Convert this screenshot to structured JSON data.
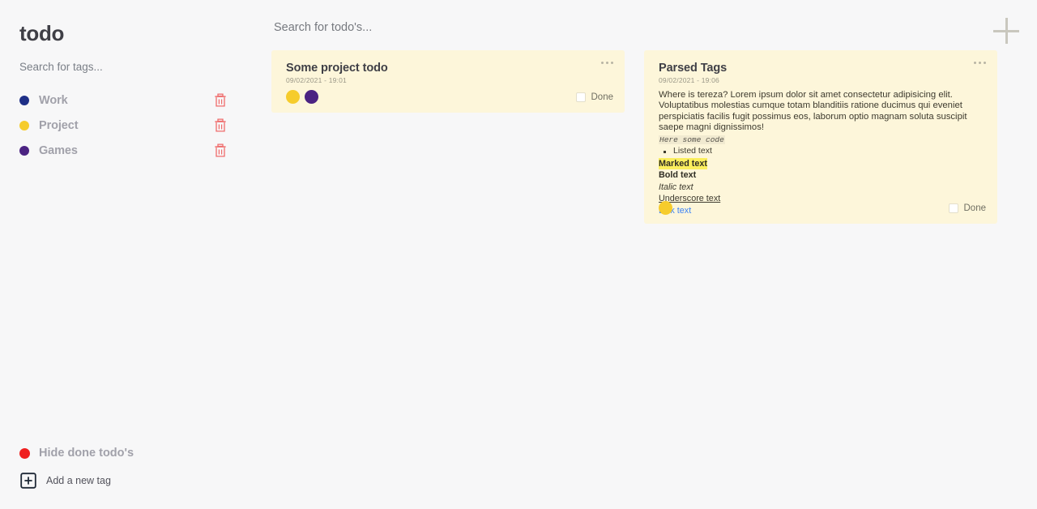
{
  "app": {
    "title": "todo",
    "background_color": "#f7f7f8",
    "card_color": "#fdf6da"
  },
  "sidebar": {
    "tag_search_placeholder": "Search for tags...",
    "tag_search_value": "",
    "tags": [
      {
        "label": "Work",
        "color": "#1e2f87",
        "delete_icon": "trash-icon"
      },
      {
        "label": "Project",
        "color": "#f6cc2c",
        "delete_icon": "trash-icon"
      },
      {
        "label": "Games",
        "color": "#4b2382",
        "delete_icon": "trash-icon"
      }
    ],
    "hide_done": {
      "label": "Hide done todo's",
      "dot_color": "#ef2020"
    },
    "add_tag": {
      "label": "Add a new tag",
      "icon": "plus-square-icon"
    }
  },
  "topbar": {
    "search_placeholder": "Search for todo's...",
    "search_value": "",
    "add_button_icon": "plus-icon"
  },
  "cards": [
    {
      "title": "Some project todo",
      "date": "09/02/2021 - 19:01",
      "menu_icon": "ellipsis-icon",
      "tag_colors": [
        "#f6cc2c",
        "#4b2382"
      ],
      "done_label": "Done",
      "done_checked": false,
      "body": null
    },
    {
      "title": "Parsed Tags",
      "date": "09/02/2021 - 19:06",
      "menu_icon": "ellipsis-icon",
      "tag_colors": [
        "#f6cc2c"
      ],
      "done_label": "Done",
      "done_checked": false,
      "body": {
        "paragraph": "Where is tereza? Lorem ipsum dolor sit amet consectetur adipisicing elit. Voluptatibus molestias cumque totam blanditiis ratione ducimus qui eveniet perspiciatis facilis fugit possimus eos, laborum optio magnam soluta suscipit saepe magni dignissimos!",
        "code": "Here some code",
        "list_item": "Listed text",
        "marked": "Marked text",
        "bold": "Bold text",
        "italic": "Italic text",
        "underscore": "Underscore text",
        "link": "Link text"
      }
    }
  ]
}
